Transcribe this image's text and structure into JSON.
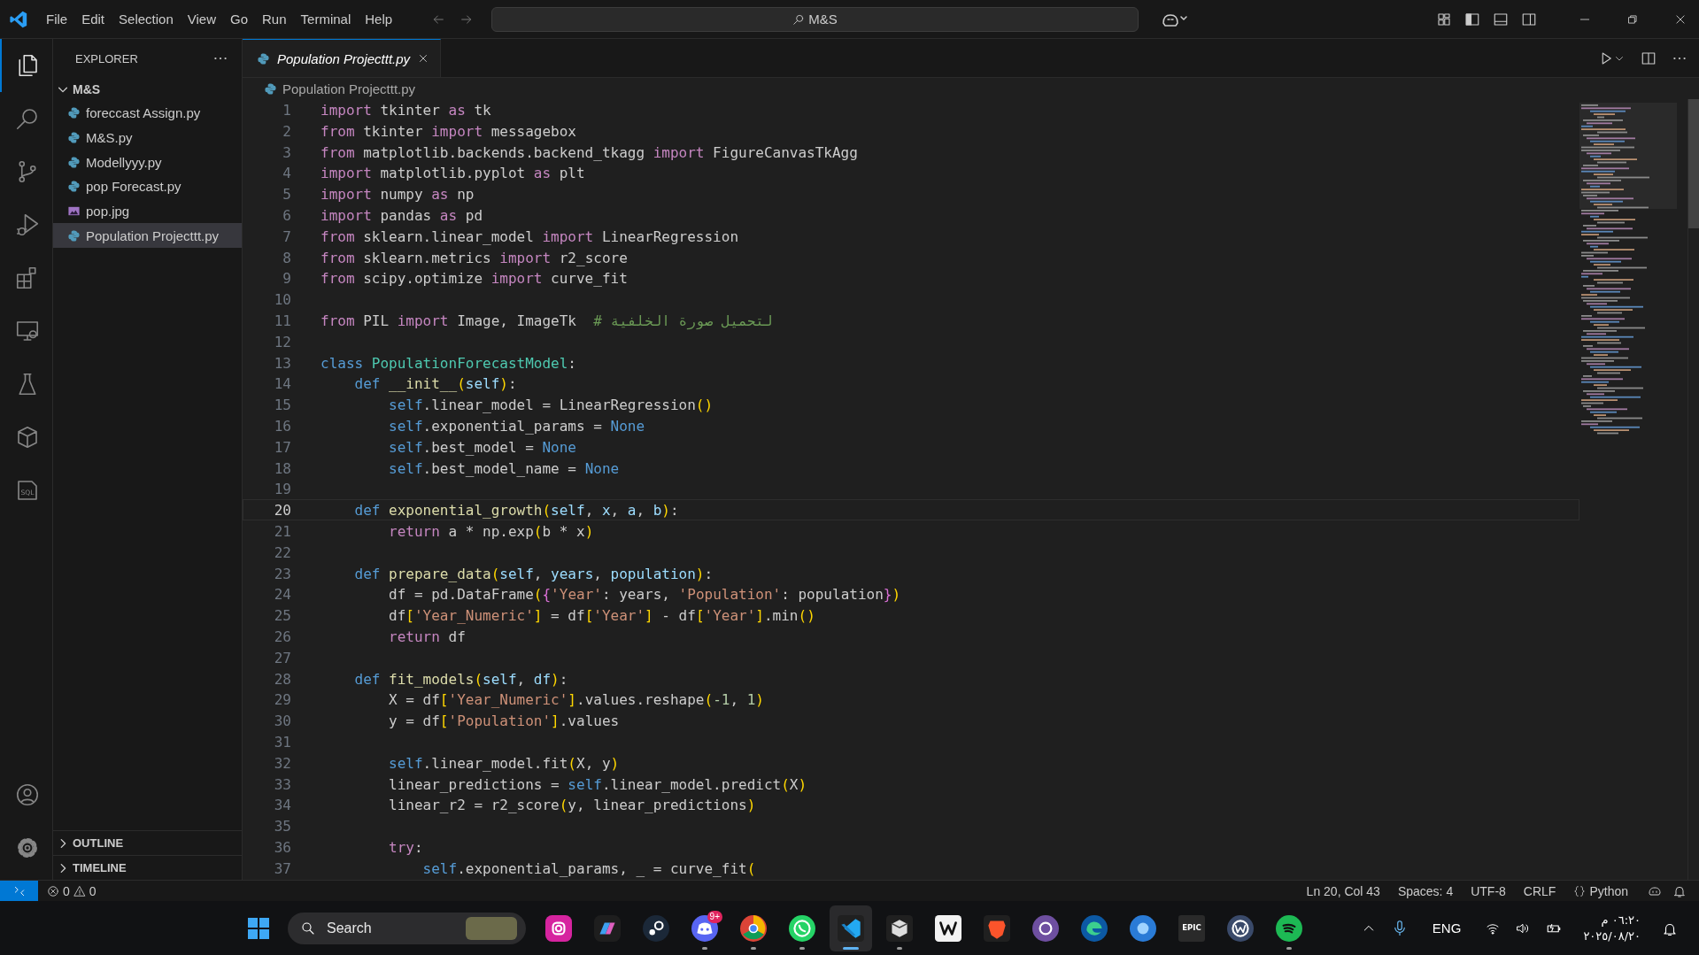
{
  "title_bar": {
    "menu": [
      "File",
      "Edit",
      "Selection",
      "View",
      "Go",
      "Run",
      "Terminal",
      "Help"
    ],
    "command_center": "M&S"
  },
  "activity_bar": {
    "items": [
      {
        "kind": "explorer",
        "selected": true
      },
      {
        "kind": "search",
        "selected": false
      },
      {
        "kind": "source-control",
        "selected": false
      },
      {
        "kind": "run-debug",
        "selected": false
      },
      {
        "kind": "extensions",
        "selected": false
      },
      {
        "kind": "remote",
        "selected": false
      },
      {
        "kind": "testing",
        "selected": false
      },
      {
        "kind": "package",
        "selected": false
      },
      {
        "kind": "sql",
        "selected": false,
        "label": "SQL"
      }
    ],
    "bottom": [
      {
        "kind": "account"
      },
      {
        "kind": "settings"
      }
    ]
  },
  "sidebar": {
    "title": "EXPLORER",
    "folder": {
      "name": "M&S",
      "expanded": true,
      "children": [
        {
          "name": "foreccast Assign.py",
          "kind": "python",
          "selected": false
        },
        {
          "name": "M&S.py",
          "kind": "python",
          "selected": false
        },
        {
          "name": "Modellyyy.py",
          "kind": "python",
          "selected": false
        },
        {
          "name": "pop Forecast.py",
          "kind": "python",
          "selected": false
        },
        {
          "name": "pop.jpg",
          "kind": "image",
          "selected": false
        },
        {
          "name": "Population Projecttt.py",
          "kind": "python",
          "selected": true
        }
      ]
    },
    "sections": [
      {
        "name": "OUTLINE",
        "expanded": false
      },
      {
        "name": "TIMELINE",
        "expanded": false
      }
    ]
  },
  "editor": {
    "tabs": [
      {
        "label": "Population Projecttt.py",
        "selected": true,
        "preview": true
      }
    ],
    "breadcrumb": "Population Projecttt.py",
    "lines": [
      {
        "number": "1",
        "current": false,
        "tokens": [
          {
            "kind": "keyword",
            "text": "import"
          },
          {
            "kind": "text",
            "text": " tkinter "
          },
          {
            "kind": "keyword",
            "text": "as"
          },
          {
            "kind": "text",
            "text": " tk"
          }
        ]
      },
      {
        "number": "2",
        "current": false,
        "tokens": [
          {
            "kind": "keyword",
            "text": "from"
          },
          {
            "kind": "text",
            "text": " tkinter "
          },
          {
            "kind": "keyword",
            "text": "import"
          },
          {
            "kind": "text",
            "text": " messagebox"
          }
        ]
      },
      {
        "number": "3",
        "current": false,
        "tokens": [
          {
            "kind": "keyword",
            "text": "from"
          },
          {
            "kind": "text",
            "text": " matplotlib.backends.backend_tkagg "
          },
          {
            "kind": "keyword",
            "text": "import"
          },
          {
            "kind": "text",
            "text": " FigureCanvasTkAgg"
          }
        ]
      },
      {
        "number": "4",
        "current": false,
        "tokens": [
          {
            "kind": "keyword",
            "text": "import"
          },
          {
            "kind": "text",
            "text": " matplotlib.pyplot "
          },
          {
            "kind": "keyword",
            "text": "as"
          },
          {
            "kind": "text",
            "text": " plt"
          }
        ]
      },
      {
        "number": "5",
        "current": false,
        "tokens": [
          {
            "kind": "keyword",
            "text": "import"
          },
          {
            "kind": "text",
            "text": " numpy "
          },
          {
            "kind": "keyword",
            "text": "as"
          },
          {
            "kind": "text",
            "text": " np"
          }
        ]
      },
      {
        "number": "6",
        "current": false,
        "tokens": [
          {
            "kind": "keyword",
            "text": "import"
          },
          {
            "kind": "text",
            "text": " pandas "
          },
          {
            "kind": "keyword",
            "text": "as"
          },
          {
            "kind": "text",
            "text": " pd"
          }
        ]
      },
      {
        "number": "7",
        "current": false,
        "tokens": [
          {
            "kind": "keyword",
            "text": "from"
          },
          {
            "kind": "text",
            "text": " sklearn.linear_model "
          },
          {
            "kind": "keyword",
            "text": "import"
          },
          {
            "kind": "text",
            "text": " LinearRegression"
          }
        ]
      },
      {
        "number": "8",
        "current": false,
        "tokens": [
          {
            "kind": "keyword",
            "text": "from"
          },
          {
            "kind": "text",
            "text": " sklearn.metrics "
          },
          {
            "kind": "keyword",
            "text": "import"
          },
          {
            "kind": "text",
            "text": " r2_score"
          }
        ]
      },
      {
        "number": "9",
        "current": false,
        "tokens": [
          {
            "kind": "keyword",
            "text": "from"
          },
          {
            "kind": "text",
            "text": " scipy.optimize "
          },
          {
            "kind": "keyword",
            "text": "import"
          },
          {
            "kind": "text",
            "text": " curve_fit"
          }
        ]
      },
      {
        "number": "10",
        "current": false
      },
      {
        "number": "11",
        "current": false,
        "tokens": [
          {
            "kind": "keyword",
            "text": "from"
          },
          {
            "kind": "text",
            "text": " PIL "
          },
          {
            "kind": "keyword",
            "text": "import"
          },
          {
            "kind": "text",
            "text": " Image, ImageTk  "
          },
          {
            "kind": "comment",
            "text": "# لتحميل صورة الخلفية"
          }
        ]
      },
      {
        "number": "12",
        "current": false
      },
      {
        "number": "13",
        "current": false,
        "tokens": [
          {
            "kind": "storage",
            "text": "class "
          },
          {
            "kind": "class",
            "text": "PopulationForecastModel"
          },
          {
            "kind": "text",
            "text": ":"
          }
        ]
      },
      {
        "number": "14",
        "current": false,
        "tokens": [
          {
            "kind": "storage",
            "text": "    def "
          },
          {
            "kind": "function",
            "text": "__init__"
          },
          {
            "kind": "bracket1",
            "text": "("
          },
          {
            "kind": "parameter",
            "text": "self"
          },
          {
            "kind": "bracket1",
            "text": ")"
          },
          {
            "kind": "text",
            "text": ":"
          }
        ]
      },
      {
        "number": "15",
        "current": false,
        "tokens": [
          {
            "kind": "storage",
            "text": "        self"
          },
          {
            "kind": "text",
            "text": ".linear_model = LinearRegression"
          },
          {
            "kind": "bracket1",
            "text": "()"
          }
        ]
      },
      {
        "number": "16",
        "current": false,
        "tokens": [
          {
            "kind": "storage",
            "text": "        self"
          },
          {
            "kind": "text",
            "text": ".exponential_params = "
          },
          {
            "kind": "storage",
            "text": "None"
          }
        ]
      },
      {
        "number": "17",
        "current": false,
        "tokens": [
          {
            "kind": "storage",
            "text": "        self"
          },
          {
            "kind": "text",
            "text": ".best_model = "
          },
          {
            "kind": "storage",
            "text": "None"
          }
        ]
      },
      {
        "number": "18",
        "current": false,
        "tokens": [
          {
            "kind": "storage",
            "text": "        self"
          },
          {
            "kind": "text",
            "text": ".best_model_name = "
          },
          {
            "kind": "storage",
            "text": "None"
          }
        ]
      },
      {
        "number": "19",
        "current": false
      },
      {
        "number": "20",
        "current": true,
        "tokens": [
          {
            "kind": "storage",
            "text": "    def "
          },
          {
            "kind": "function",
            "text": "exponential_growth"
          },
          {
            "kind": "bracket1",
            "text": "("
          },
          {
            "kind": "parameter",
            "text": "self"
          },
          {
            "kind": "text",
            "text": ", "
          },
          {
            "kind": "parameter",
            "text": "x"
          },
          {
            "kind": "text",
            "text": ", "
          },
          {
            "kind": "parameter",
            "text": "a"
          },
          {
            "kind": "text",
            "text": ", "
          },
          {
            "kind": "parameter",
            "text": "b"
          },
          {
            "kind": "bracket1",
            "text": ")"
          },
          {
            "kind": "text",
            "text": ":"
          }
        ]
      },
      {
        "number": "21",
        "current": false,
        "tokens": [
          {
            "kind": "keyword",
            "text": "        return"
          },
          {
            "kind": "text",
            "text": " a * np.exp"
          },
          {
            "kind": "bracket1",
            "text": "("
          },
          {
            "kind": "text",
            "text": "b * x"
          },
          {
            "kind": "bracket1",
            "text": ")"
          }
        ]
      },
      {
        "number": "22",
        "current": false
      },
      {
        "number": "23",
        "current": false,
        "tokens": [
          {
            "kind": "storage",
            "text": "    def "
          },
          {
            "kind": "function",
            "text": "prepare_data"
          },
          {
            "kind": "bracket1",
            "text": "("
          },
          {
            "kind": "parameter",
            "text": "self"
          },
          {
            "kind": "text",
            "text": ", "
          },
          {
            "kind": "parameter",
            "text": "years"
          },
          {
            "kind": "text",
            "text": ", "
          },
          {
            "kind": "parameter",
            "text": "population"
          },
          {
            "kind": "bracket1",
            "text": ")"
          },
          {
            "kind": "text",
            "text": ":"
          }
        ]
      },
      {
        "number": "24",
        "current": false,
        "tokens": [
          {
            "kind": "text",
            "text": "        df = pd.DataFrame"
          },
          {
            "kind": "bracket1",
            "text": "("
          },
          {
            "kind": "bracket2",
            "text": "{"
          },
          {
            "kind": "string",
            "text": "'Year'"
          },
          {
            "kind": "text",
            "text": ": years, "
          },
          {
            "kind": "string",
            "text": "'Population'"
          },
          {
            "kind": "text",
            "text": ": population"
          },
          {
            "kind": "bracket2",
            "text": "}"
          },
          {
            "kind": "bracket1",
            "text": ")"
          }
        ]
      },
      {
        "number": "25",
        "current": false,
        "tokens": [
          {
            "kind": "text",
            "text": "        df"
          },
          {
            "kind": "bracket1",
            "text": "["
          },
          {
            "kind": "string",
            "text": "'Year_Numeric'"
          },
          {
            "kind": "bracket1",
            "text": "]"
          },
          {
            "kind": "text",
            "text": " = df"
          },
          {
            "kind": "bracket1",
            "text": "["
          },
          {
            "kind": "string",
            "text": "'Year'"
          },
          {
            "kind": "bracket1",
            "text": "]"
          },
          {
            "kind": "text",
            "text": " - df"
          },
          {
            "kind": "bracket1",
            "text": "["
          },
          {
            "kind": "string",
            "text": "'Year'"
          },
          {
            "kind": "bracket1",
            "text": "]"
          },
          {
            "kind": "text",
            "text": ".min"
          },
          {
            "kind": "bracket1",
            "text": "()"
          }
        ]
      },
      {
        "number": "26",
        "current": false,
        "tokens": [
          {
            "kind": "keyword",
            "text": "        return"
          },
          {
            "kind": "text",
            "text": " df"
          }
        ]
      },
      {
        "number": "27",
        "current": false
      },
      {
        "number": "28",
        "current": false,
        "tokens": [
          {
            "kind": "storage",
            "text": "    def "
          },
          {
            "kind": "function",
            "text": "fit_models"
          },
          {
            "kind": "bracket1",
            "text": "("
          },
          {
            "kind": "parameter",
            "text": "self"
          },
          {
            "kind": "text",
            "text": ", "
          },
          {
            "kind": "parameter",
            "text": "df"
          },
          {
            "kind": "bracket1",
            "text": ")"
          },
          {
            "kind": "text",
            "text": ":"
          }
        ]
      },
      {
        "number": "29",
        "current": false,
        "tokens": [
          {
            "kind": "text",
            "text": "        X = df"
          },
          {
            "kind": "bracket1",
            "text": "["
          },
          {
            "kind": "string",
            "text": "'Year_Numeric'"
          },
          {
            "kind": "bracket1",
            "text": "]"
          },
          {
            "kind": "text",
            "text": ".values.reshape"
          },
          {
            "kind": "bracket1",
            "text": "("
          },
          {
            "kind": "number",
            "text": "-1"
          },
          {
            "kind": "text",
            "text": ", "
          },
          {
            "kind": "number",
            "text": "1"
          },
          {
            "kind": "bracket1",
            "text": ")"
          }
        ]
      },
      {
        "number": "30",
        "current": false,
        "tokens": [
          {
            "kind": "text",
            "text": "        y = df"
          },
          {
            "kind": "bracket1",
            "text": "["
          },
          {
            "kind": "string",
            "text": "'Population'"
          },
          {
            "kind": "bracket1",
            "text": "]"
          },
          {
            "kind": "text",
            "text": ".values"
          }
        ]
      },
      {
        "number": "31",
        "current": false
      },
      {
        "number": "32",
        "current": false,
        "tokens": [
          {
            "kind": "storage",
            "text": "        self"
          },
          {
            "kind": "text",
            "text": ".linear_model.fit"
          },
          {
            "kind": "bracket1",
            "text": "("
          },
          {
            "kind": "text",
            "text": "X, y"
          },
          {
            "kind": "bracket1",
            "text": ")"
          }
        ]
      },
      {
        "number": "33",
        "current": false,
        "tokens": [
          {
            "kind": "text",
            "text": "        linear_predictions = "
          },
          {
            "kind": "storage",
            "text": "self"
          },
          {
            "kind": "text",
            "text": ".linear_model.predict"
          },
          {
            "kind": "bracket1",
            "text": "("
          },
          {
            "kind": "text",
            "text": "X"
          },
          {
            "kind": "bracket1",
            "text": ")"
          }
        ]
      },
      {
        "number": "34",
        "current": false,
        "tokens": [
          {
            "kind": "text",
            "text": "        linear_r2 = r2_score"
          },
          {
            "kind": "bracket1",
            "text": "("
          },
          {
            "kind": "text",
            "text": "y, linear_predictions"
          },
          {
            "kind": "bracket1",
            "text": ")"
          }
        ]
      },
      {
        "number": "35",
        "current": false
      },
      {
        "number": "36",
        "current": false,
        "tokens": [
          {
            "kind": "keyword",
            "text": "        try"
          },
          {
            "kind": "text",
            "text": ":"
          }
        ]
      },
      {
        "number": "37",
        "current": false,
        "tokens": [
          {
            "kind": "storage",
            "text": "            self"
          },
          {
            "kind": "text",
            "text": ".exponential_params, _ = curve_fit"
          },
          {
            "kind": "bracket1",
            "text": "("
          }
        ]
      }
    ]
  },
  "status_bar": {
    "errors": "0",
    "warnings": "0",
    "items": [
      "Ln 20, Col 43",
      "Spaces: 4",
      "UTF-8",
      "CRLF"
    ],
    "language": "Python"
  },
  "taskbar": {
    "search": "Search",
    "apps": [
      {
        "kind": "instagram",
        "running": false,
        "selected": false
      },
      {
        "kind": "copilot",
        "running": false,
        "selected": false
      },
      {
        "kind": "steam",
        "running": false,
        "selected": false
      },
      {
        "kind": "discord",
        "running": true,
        "selected": false,
        "badge": "9+"
      },
      {
        "kind": "chrome",
        "running": true,
        "selected": false
      },
      {
        "kind": "whatsapp",
        "running": true,
        "selected": false
      },
      {
        "kind": "vscode",
        "running": true,
        "selected": true
      },
      {
        "kind": "cube",
        "running": true,
        "selected": false
      },
      {
        "kind": "writer",
        "running": false,
        "selected": false
      },
      {
        "kind": "brave",
        "running": false,
        "selected": false
      },
      {
        "kind": "torrent",
        "running": false,
        "selected": false
      },
      {
        "kind": "edge",
        "running": false,
        "selected": false
      },
      {
        "kind": "photos",
        "running": false,
        "selected": false
      },
      {
        "kind": "epic",
        "running": false,
        "selected": false,
        "label": "EPIC"
      },
      {
        "kind": "wcircle",
        "running": false,
        "selected": false
      },
      {
        "kind": "spotify",
        "running": true,
        "selected": false
      }
    ],
    "tray": {
      "language": "ENG",
      "time": "٠٦:٢٠ م",
      "date": "٢٠٢٥/٠٨/٢٠"
    }
  }
}
